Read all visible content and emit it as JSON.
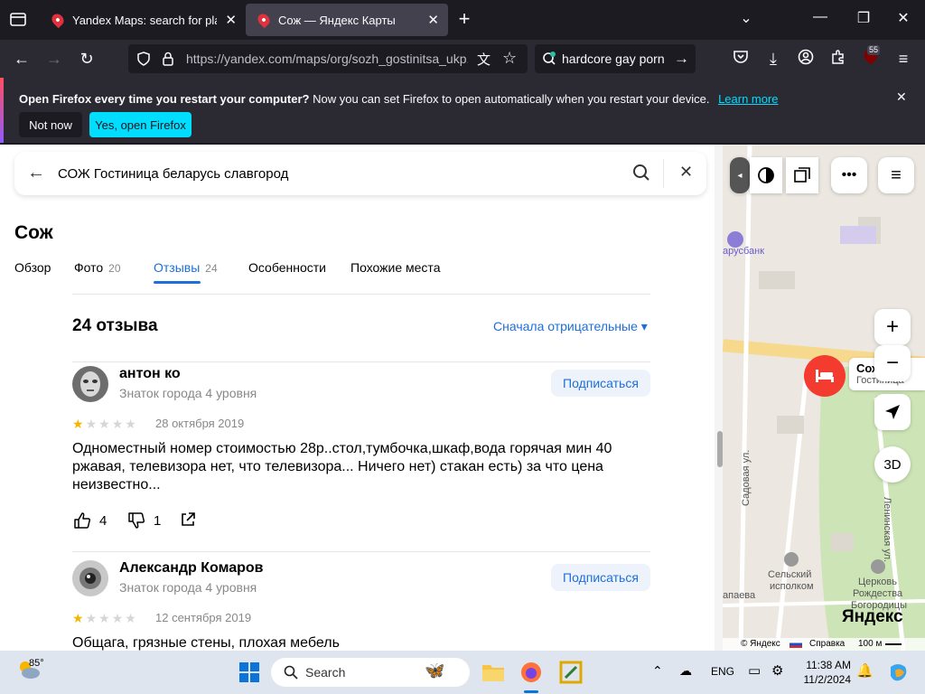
{
  "browser": {
    "tabs": [
      {
        "title": "Yandex Maps: search for places",
        "active": false
      },
      {
        "title": "Сож — Яндекс Карты",
        "active": true
      }
    ],
    "url": "https://yandex.com/maps/org/sozh_gostinitsa_ukp...",
    "search_text": "hardcore gay porn",
    "extension_badge": "55"
  },
  "notification": {
    "bold": "Open Firefox every time you restart your computer?",
    "message": "Now you can set Firefox to open automatically when you restart your device.",
    "learn_more": "Learn more",
    "not_now": "Not now",
    "yes_open": "Yes, open Firefox"
  },
  "page": {
    "search_query": "СОЖ Гостиница беларусь славгород",
    "title": "Сож",
    "tabs": [
      {
        "label": "Обзор",
        "count": ""
      },
      {
        "label": "Фото",
        "count": "20"
      },
      {
        "label": "Отзывы",
        "count": "24"
      },
      {
        "label": "Особенности",
        "count": ""
      },
      {
        "label": "Похожие места",
        "count": ""
      }
    ],
    "reviews_heading": "24 отзыва",
    "sort_label": "Сначала отрицательные ▾",
    "reviews": [
      {
        "name": "антон ко",
        "level": "Знаток города 4 уровня",
        "subscribe": "Подписаться",
        "rating": 1,
        "date": "28 октября 2019",
        "text": "Одноместный номер стоимостью 28р..стол,тумбочка,шкаф,вода горячая мин 40 ржавая, телевизора нет, что телевизора... Ничего нет) стакан есть) за что цена неизвестно...",
        "likes": "4",
        "dislikes": "1"
      },
      {
        "name": "Александр Комаров",
        "level": "Знаток города 4 уровня",
        "subscribe": "Подписаться",
        "rating": 1,
        "date": "12 сентября 2019",
        "text": "Общага, грязные стены, плохая мебель",
        "likes": "",
        "dislikes": ""
      }
    ]
  },
  "map": {
    "labels": {
      "bank": "арусбанк",
      "place_name": "Сож",
      "place_sub": "Гостиница",
      "sadovaya": "Садовая ул.",
      "leninskaya": "Ленинская ул.",
      "selsky": "Сельский",
      "ispolkom": "исполком",
      "church1": "Церковь",
      "church2": "Рождества",
      "church3": "Богородицы",
      "aparaeva": "апаева",
      "yandex_logo": "Яндекс",
      "footer_yandex": "© Яндекс",
      "footer_help": "Справка",
      "scale": "100 м",
      "three_d": "3D"
    }
  },
  "taskbar": {
    "weather_temp": "85°",
    "search_placeholder": "Search",
    "lang": "ENG",
    "time": "11:38 AM",
    "date": "11/2/2024"
  }
}
